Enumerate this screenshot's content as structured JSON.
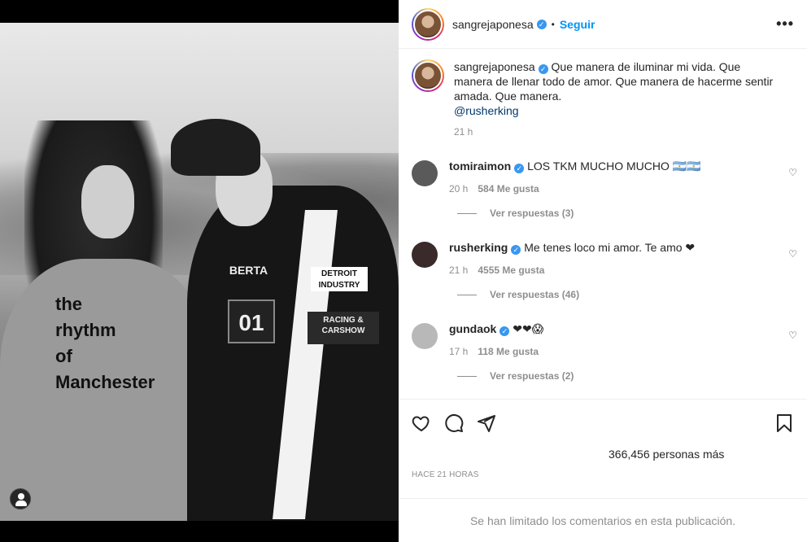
{
  "post_header": {
    "username": "sangrejaponesa",
    "follow_label": "Seguir",
    "more_label": "•••"
  },
  "caption": {
    "username": "sangrejaponesa",
    "text": "Que manera de iluminar mi vida. Que manera de llenar todo de amor. Que manera de hacerme sentir amada. Que manera.",
    "mention": "@rusherking",
    "time": "21 h"
  },
  "photo": {
    "shirt_text": [
      "the",
      "rhythm",
      "of",
      "Manchester"
    ],
    "patches": {
      "berta": "BERTA",
      "detroit": "DETROIT INDUSTRY",
      "number": "01",
      "racing": "RACING & CARSHOW"
    }
  },
  "comments": [
    {
      "username": "tomiraimon",
      "text": "LOS TKM MUCHO MUCHO 🇦🇷🇦🇷",
      "time": "20 h",
      "likes": "584 Me gusta",
      "replies": "Ver respuestas (3)",
      "avatar_color": "#5a5a5a"
    },
    {
      "username": "rusherking",
      "text": "Me tenes loco mi amor. Te amo ❤",
      "time": "21 h",
      "likes": "4555 Me gusta",
      "replies": "Ver respuestas (46)",
      "avatar_color": "#3a2a2a"
    },
    {
      "username": "gundaok",
      "text": "❤❤😱",
      "time": "17 h",
      "likes": "118 Me gusta",
      "replies": "Ver respuestas (2)",
      "avatar_color": "#b8b8b8"
    }
  ],
  "likes_summary": "366,456 personas más",
  "posted_ago": "HACE 21 HORAS",
  "comments_limited": "Se han limitado los comentarios en esta publicación.",
  "colors": {
    "link_blue": "#0095f6",
    "mention_blue": "#00376b",
    "verified_blue": "#3897f0",
    "muted": "#8e8e8e",
    "heart_red": "#ed4956"
  }
}
